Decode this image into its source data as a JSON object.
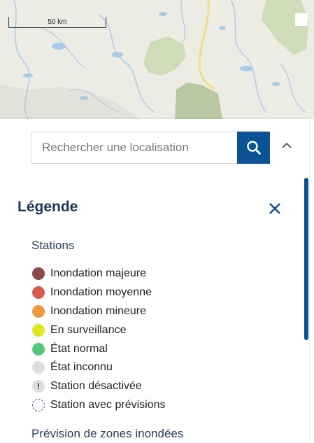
{
  "map": {
    "scale_label": "50 km",
    "colors": {
      "land": "#ecebe4",
      "water": "#a9cbe8",
      "park": "#c9d7b0",
      "park_dark": "#b8c8a0",
      "road": "#f2de8a"
    }
  },
  "search": {
    "placeholder": "Rechercher une localisation",
    "value": "",
    "button_icon": "search-icon",
    "collapse_icon": "chevron-up-icon"
  },
  "legend": {
    "title": "Légende",
    "close_icon": "close-icon",
    "sections": [
      {
        "title": "Stations",
        "items": [
          {
            "label": "Inondation majeure",
            "color": "#8b4a4a",
            "icon": "circle"
          },
          {
            "label": "Inondation moyenne",
            "color": "#d9594c",
            "icon": "circle"
          },
          {
            "label": "Inondation mineure",
            "color": "#ec9a3b",
            "icon": "circle"
          },
          {
            "label": "En surveillance",
            "color": "#dde820",
            "icon": "circle"
          },
          {
            "label": "État normal",
            "color": "#54c67a",
            "icon": "circle"
          },
          {
            "label": "État inconnu",
            "color": "#dedede",
            "icon": "circle"
          },
          {
            "label": "Station désactivée",
            "color": "#dedede",
            "icon": "exclamation-icon",
            "symbol": "!"
          },
          {
            "label": "Station avec prévisions",
            "color": "#3a4fb5",
            "icon": "dashed-circle"
          }
        ]
      },
      {
        "title": "Prévision de zones inondées"
      }
    ]
  },
  "colors": {
    "accent": "#0b5394",
    "heading": "#1f3659"
  }
}
